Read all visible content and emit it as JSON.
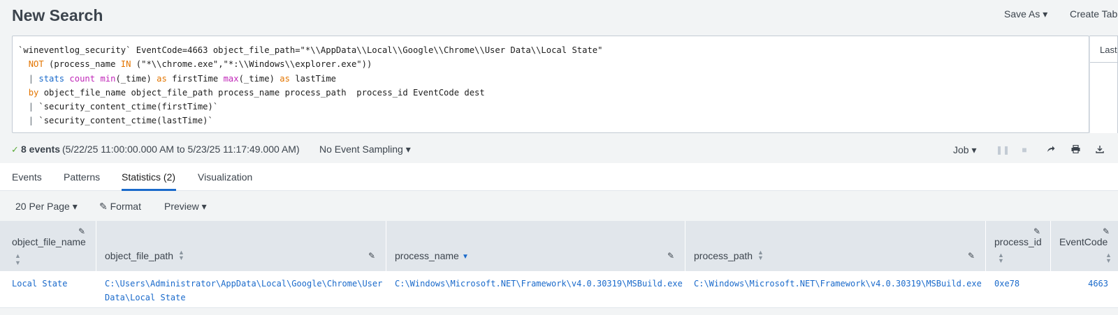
{
  "header": {
    "title": "New Search",
    "save_as": "Save As ▾",
    "create_table": "Create Tab"
  },
  "search": {
    "line1": "`wineventlog_security` EventCode=4663 object_file_path=\"*\\\\AppData\\\\Local\\\\Google\\\\Chrome\\\\User Data\\\\Local State\"",
    "line2_kw": "NOT",
    "line2_rest": " (process_name ",
    "line2_in": "IN",
    "line2_tail": " (\"*\\\\chrome.exe\",\"*:\\\\Windows\\\\explorer.exe\"))",
    "line3_pipe": "| ",
    "line3_stats": "stats",
    "line3_count": "count",
    "line3_min": "min",
    "line3_a": "(_time) ",
    "line3_as1": "as",
    "line3_b": " firstTime ",
    "line3_max": "max",
    "line3_c": "(_time) ",
    "line3_as2": "as",
    "line3_d": " lastTime",
    "line4_by": "by",
    "line4_rest": " object_file_name object_file_path process_name process_path  process_id EventCode dest",
    "line5_pipe": "| ",
    "line5_rest": "`security_content_ctime(firstTime)`",
    "line6_pipe": "| ",
    "line6_rest": "`security_content_ctime(lastTime)`",
    "time_picker": "Last"
  },
  "status": {
    "check": "✓",
    "count": "8 events",
    "range": "(5/22/25 11:00:00.000 AM to 5/23/25 11:17:49.000 AM)",
    "sampling": "No Event Sampling ▾",
    "job": "Job ▾"
  },
  "tabs": [
    {
      "label": "Events"
    },
    {
      "label": "Patterns"
    },
    {
      "label": "Statistics (2)"
    },
    {
      "label": "Visualization"
    }
  ],
  "toolbar": {
    "per_page": "20 Per Page ▾",
    "format": "Format",
    "preview": "Preview ▾"
  },
  "table": {
    "columns": [
      {
        "label": "object_file_name",
        "sorted": false
      },
      {
        "label": "object_file_path",
        "sorted": false
      },
      {
        "label": "process_name",
        "sorted": true,
        "direction": "descending"
      },
      {
        "label": "process_path",
        "sorted": false
      },
      {
        "label": "process_id",
        "sorted": false
      },
      {
        "label": "EventCode",
        "sorted": false
      }
    ],
    "rows": [
      {
        "object_file_name": "Local State",
        "object_file_path_1": "C:\\Users\\Administrator\\AppData\\Local\\Google\\Chrome\\User",
        "object_file_path_2": "Data\\Local State",
        "process_name": "C:\\Windows\\Microsoft.NET\\Framework\\v4.0.30319\\MSBuild.exe",
        "process_path": "C:\\Windows\\Microsoft.NET\\Framework\\v4.0.30319\\MSBuild.exe",
        "process_id": "0xe78",
        "EventCode": "4663"
      }
    ]
  },
  "colors": {
    "accent": "#1a6acb",
    "keyword_orange": "#e37500",
    "keyword_pink": "#c026b8",
    "success": "#5cab3a"
  }
}
